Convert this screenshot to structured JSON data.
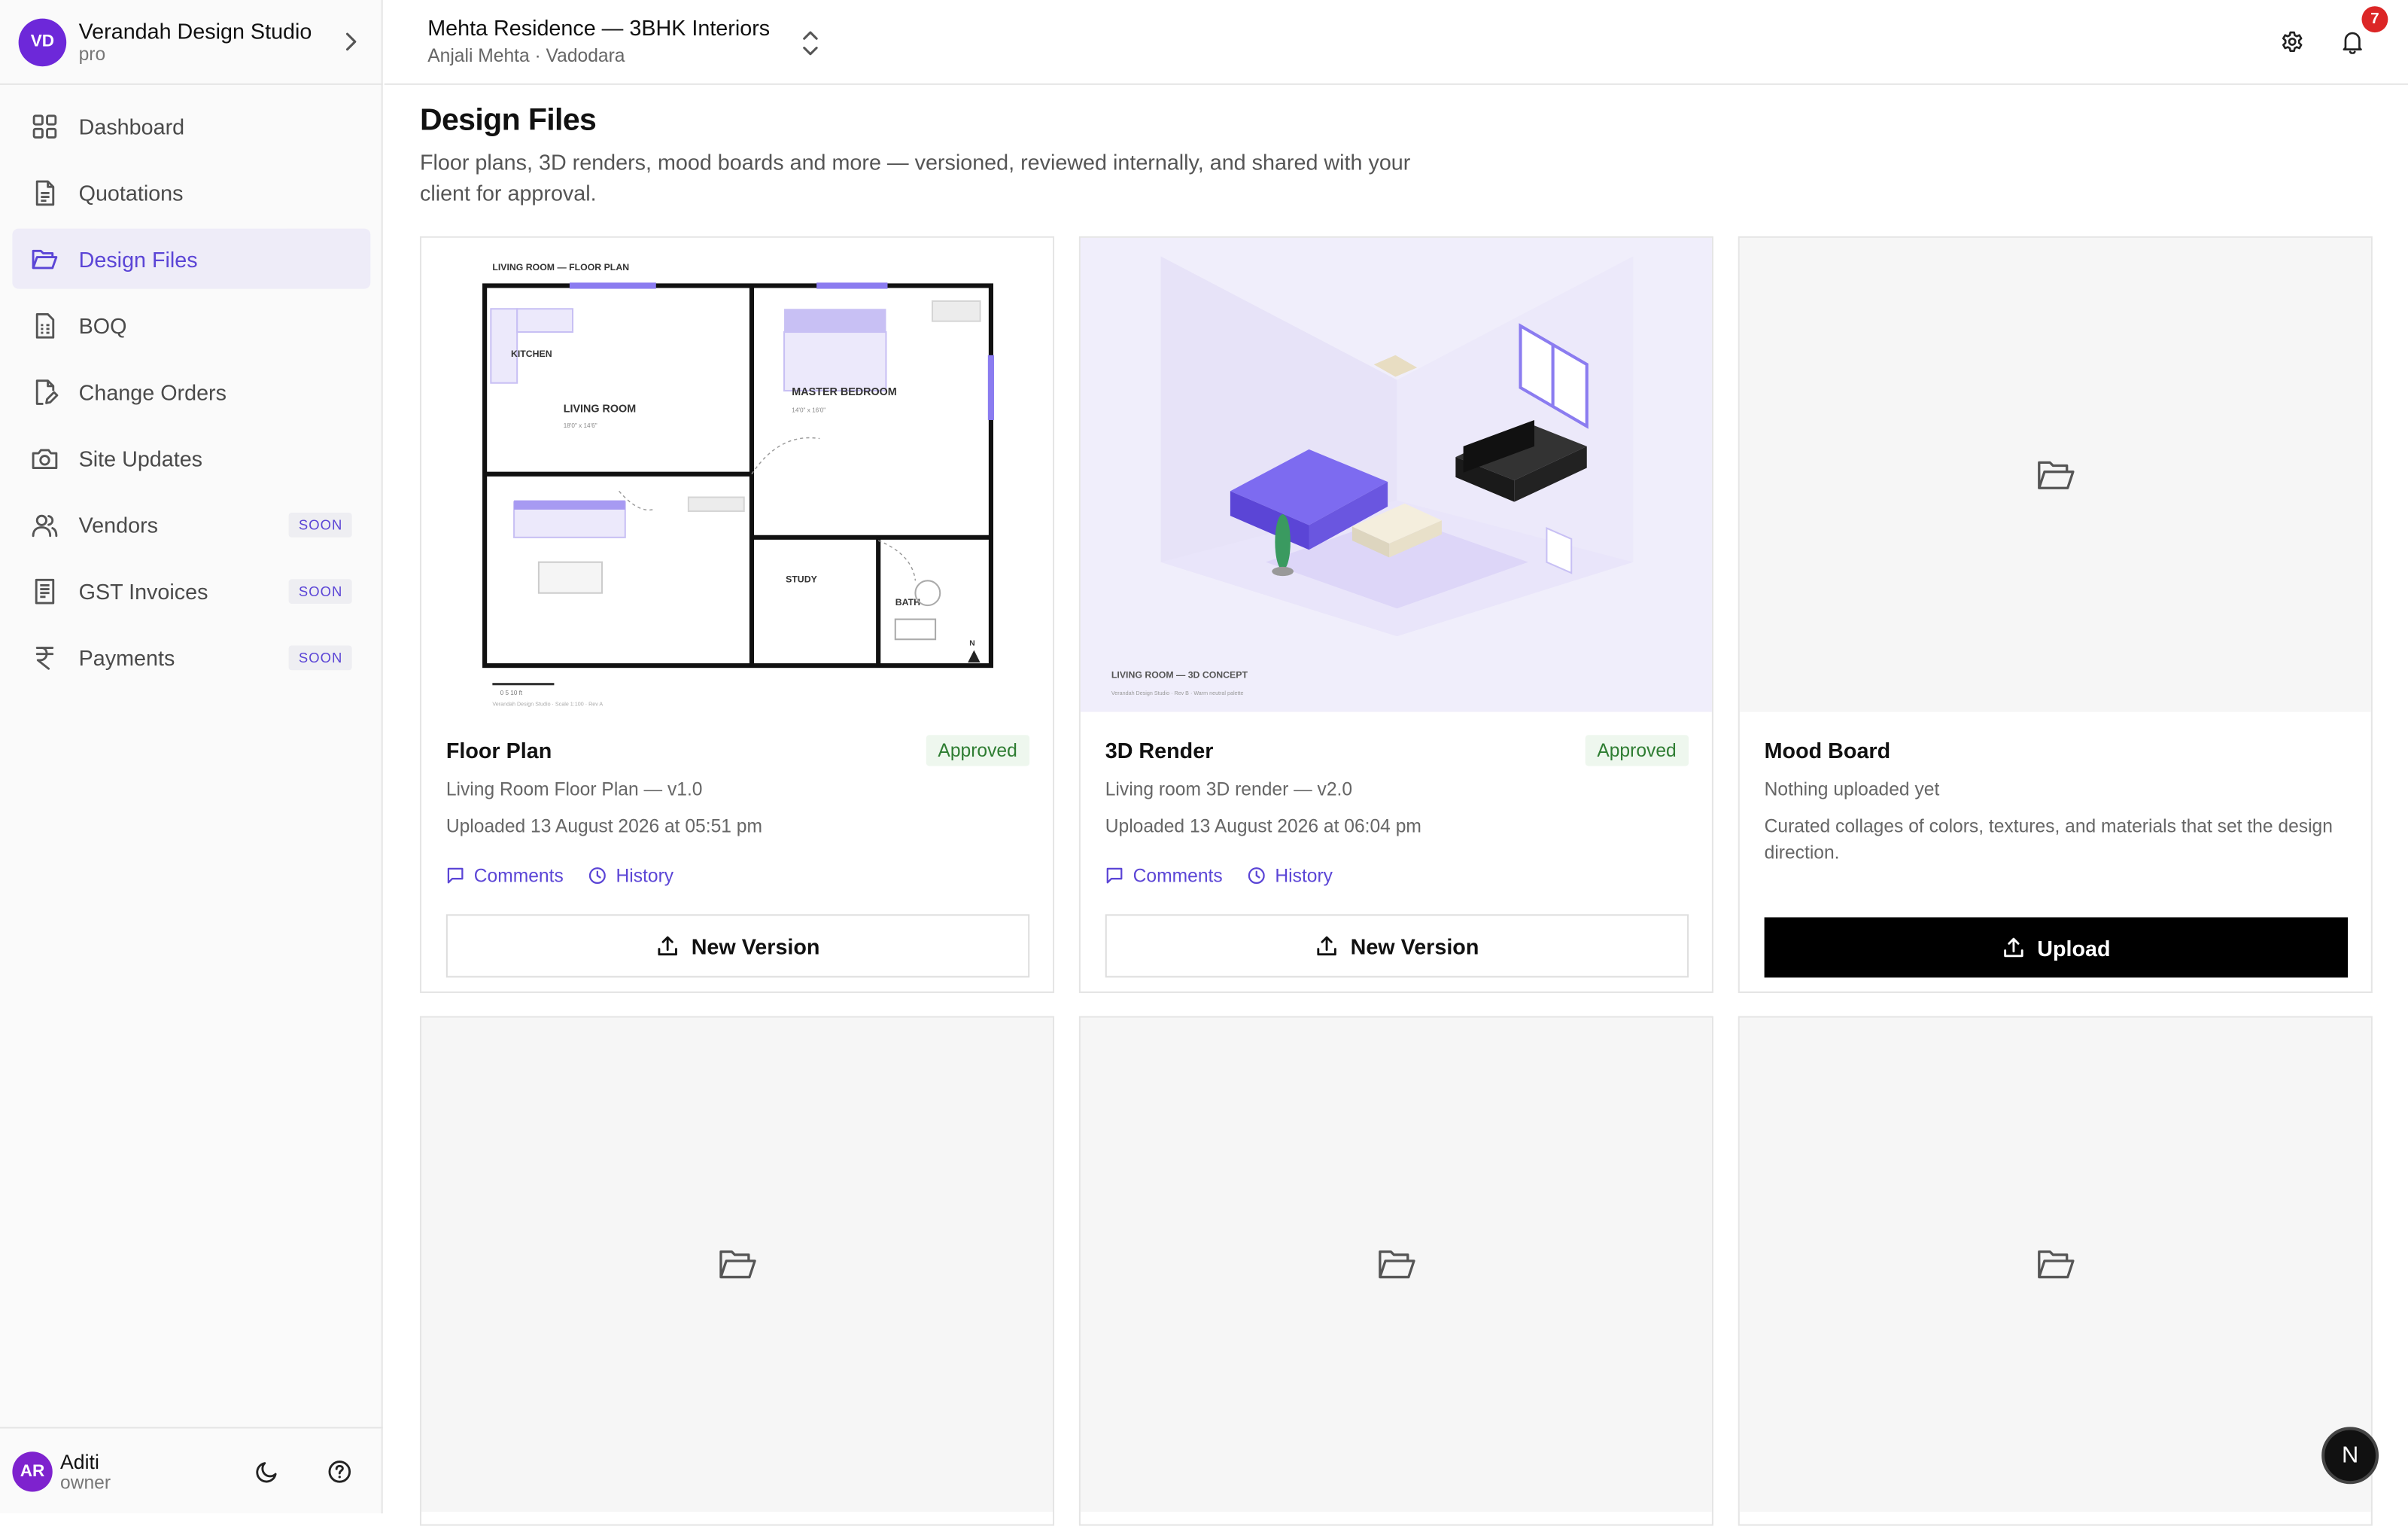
{
  "workspace": {
    "initials": "VD",
    "name": "Verandah Design Studio",
    "plan": "pro"
  },
  "nav": [
    {
      "label": "Dashboard",
      "icon": "dashboard-grid-icon"
    },
    {
      "label": "Quotations",
      "icon": "document-icon"
    },
    {
      "label": "Design Files",
      "icon": "folder-open-icon",
      "active": true
    },
    {
      "label": "BOQ",
      "icon": "spreadsheet-icon"
    },
    {
      "label": "Change Orders",
      "icon": "file-edit-icon"
    },
    {
      "label": "Site Updates",
      "icon": "camera-icon"
    },
    {
      "label": "Vendors",
      "icon": "users-icon",
      "badge": "SOON"
    },
    {
      "label": "GST Invoices",
      "icon": "receipt-icon",
      "badge": "SOON"
    },
    {
      "label": "Payments",
      "icon": "rupee-icon",
      "badge": "SOON"
    }
  ],
  "user": {
    "initials": "AR",
    "name": "Aditi",
    "role": "owner"
  },
  "project": {
    "title": "Mehta Residence — 3BHK Interiors",
    "client": "Anjali Mehta · Vadodara"
  },
  "notifications": {
    "count": "7"
  },
  "page": {
    "title": "Design Files",
    "description": "Floor plans, 3D renders, mood boards and more — versioned, reviewed internally, and shared with your client for approval."
  },
  "cards": [
    {
      "title": "Floor Plan",
      "status": "Approved",
      "file": "Living Room Floor Plan — v1.0",
      "uploaded": "Uploaded 13 August 2026 at 05:51 pm",
      "comments": "Comments",
      "history": "History",
      "action": "New Version"
    },
    {
      "title": "3D Render",
      "status": "Approved",
      "file": "Living room 3D render — v2.0",
      "uploaded": "Uploaded 13 August 2026 at 06:04 pm",
      "comments": "Comments",
      "history": "History",
      "action": "New Version"
    },
    {
      "title": "Mood Board",
      "empty": "Nothing uploaded yet",
      "description": "Curated collages of colors, textures, and materials that set the design direction.",
      "action": "Upload"
    }
  ],
  "floorplan": {
    "caption": "LIVING ROOM — FLOOR PLAN",
    "kitchen": "KITCHEN",
    "living": "LIVING ROOM",
    "living_dim": "18'0\" x 14'6\"",
    "master": "MASTER BEDROOM",
    "master_dim": "14'0\" x 16'0\"",
    "study": "STUDY",
    "bath": "BATH",
    "north": "N",
    "scale": "0  5  10 ft",
    "footer": "Verandah Design Studio · Scale 1:100 · Rev A"
  },
  "render": {
    "caption": "LIVING ROOM — 3D CONCEPT",
    "footer": "Verandah Design Studio · Rev B · Warm neutral palette"
  },
  "colors": {
    "accent": "#5b45d6",
    "approved_bg": "#eef7ee",
    "approved_text": "#2e7d32",
    "render_bg": "#f0eefb"
  },
  "fab": {
    "label": "N"
  }
}
